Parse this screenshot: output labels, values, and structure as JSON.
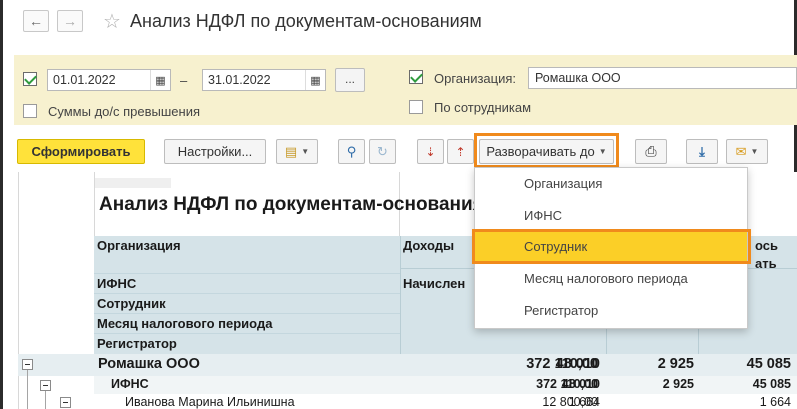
{
  "window": {
    "title": "Анализ НДФЛ по документам-основаниям",
    "back_icon": "←",
    "forward_icon": "→",
    "star_icon": "☆"
  },
  "params": {
    "date_from": "01.01.2022",
    "dash": "–",
    "date_to": "31.01.2022",
    "dots_label": "...",
    "sums_label": "Суммы до/с превышения",
    "org_label": "Организация:",
    "org_value": "Ромашка ООО",
    "by_employees_label": "По сотрудникам"
  },
  "toolbar": {
    "generate_label": "Сформировать",
    "settings_label": "Настройки...",
    "expand_label": "Разворачивать до"
  },
  "dropdown": {
    "items": [
      "Организация",
      "ИФНС",
      "Сотрудник",
      "Месяц налогового периода",
      "Регистратор"
    ],
    "selected": "Сотрудник"
  },
  "report": {
    "title": "Анализ НДФЛ по документам-основаниям",
    "headers": {
      "col1": [
        "Организация",
        "ИФНС",
        "Сотрудник",
        "Месяц налогового периода",
        "Регистратор"
      ],
      "income": "Доходы",
      "accrued": "Начислен",
      "col5_top": "ось",
      "col5_bottom": "ать"
    },
    "rows": [
      {
        "label": "Ромашка ООО",
        "v1": "372 110,00",
        "v2": "48 010",
        "v3": "2 925",
        "v4": "45 085"
      },
      {
        "label": "ИФНС",
        "v1": "372 110,00",
        "v2": "48 010",
        "v3": "2 925",
        "v4": "45 085"
      },
      {
        "label": "Иванова Марина Ильинишна",
        "v1": "12 800,00",
        "v2": "1 664",
        "v3": "",
        "v4": "1 664"
      }
    ]
  },
  "colors": {
    "accent_yellow": "#ffe23a",
    "highlight_orange": "#f08a1c",
    "params_bg": "#f7f1cf",
    "header_bg": "#d5e3e8"
  }
}
